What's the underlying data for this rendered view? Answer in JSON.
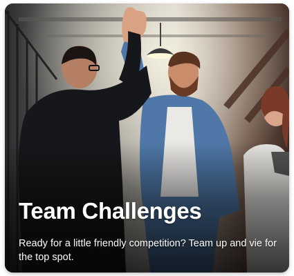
{
  "card": {
    "title": "Team Challenges",
    "description": "Ready for a little friendly competition? Team up and vie for the top spot."
  },
  "colors": {
    "title_text": "#ffffff",
    "description_text": "#ffffff",
    "scrim": "#000000"
  }
}
